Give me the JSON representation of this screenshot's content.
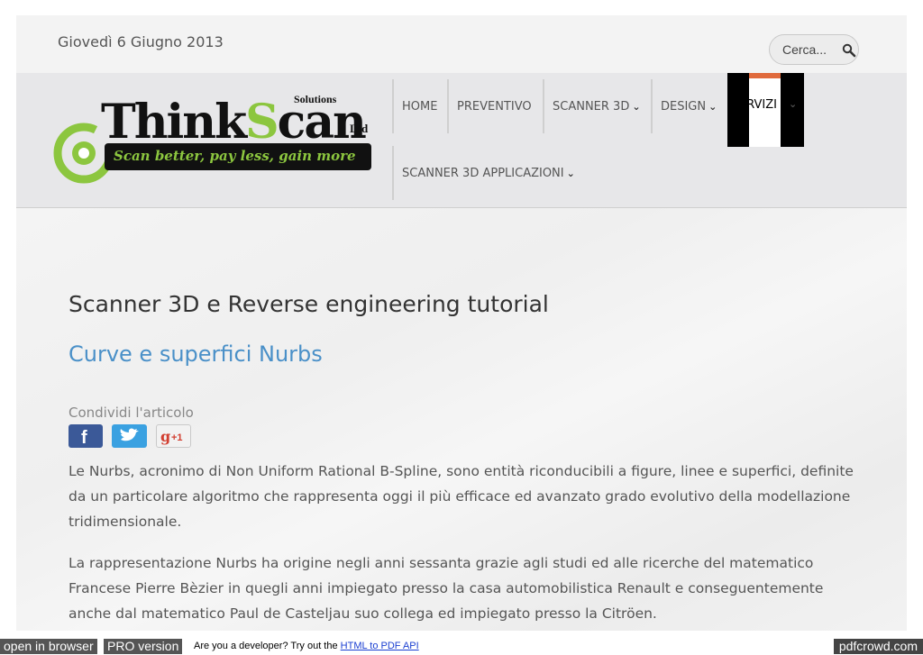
{
  "topbar": {
    "date": "Giovedì 6 Giugno 2013",
    "search_placeholder": "Cerca..."
  },
  "logo": {
    "name_part1": "Think",
    "name_s": "S",
    "name_part2": "can",
    "solutions": "Solutions",
    "ltd": "Ltd",
    "tagline": "Scan better, pay less, gain more"
  },
  "nav": {
    "home": "HOME",
    "preventivo": "PREVENTIVO",
    "scanner3d": "SCANNER 3D",
    "design": "DESIGN",
    "servizi": "ERVIZI",
    "applicazioni": "SCANNER 3D APPLICAZIONI",
    "chevron": "❯"
  },
  "article": {
    "title": "Scanner 3D e Reverse engineering tutorial",
    "subtitle": "Curve e superfici Nurbs",
    "share_label": "Condividi l'articolo",
    "gplus_label": "+1",
    "para1": "Le Nurbs, acronimo di Non Uniform Rational B-Spline, sono entità riconducibili a figure, linee e superfici, definite da un particolare algoritmo che rappresenta oggi il più efficace ed avanzato grado evolutivo della modellazione tridimensionale.",
    "para2": "La rappresentazione Nurbs ha origine negli anni sessanta grazie agli studi ed alle ricerche del matematico Francese Pierre Bèzier in quegli anni impiegato presso la casa automobilistica Renault e conseguentemente anche dal matematico Paul de Casteljau suo collega ed impiegato presso la Citröen."
  },
  "footer": {
    "open_browser": "open in browser",
    "pro_version": "PRO version",
    "dev_text": "Are you a developer? Try out the",
    "api_link": "HTML to PDF API",
    "brand": "pdfcrowd.com"
  },
  "colors": {
    "accent_blue": "#4a90c8",
    "logo_green": "#8cc63f",
    "facebook": "#3b5998",
    "twitter": "#3aa1e1"
  }
}
